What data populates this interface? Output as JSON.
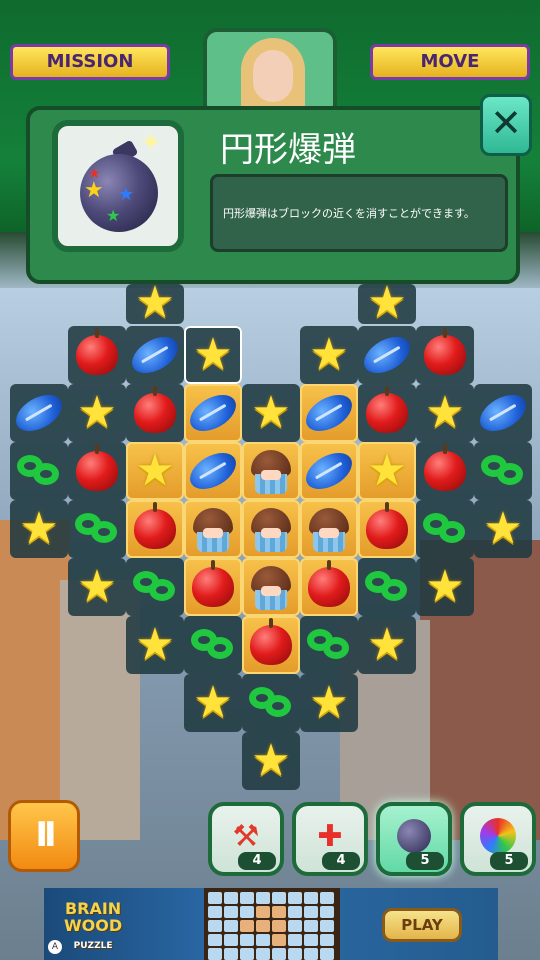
{
  "hud": {
    "mission_label": "MISSION",
    "move_label": "MOVE"
  },
  "dialog": {
    "title": "円形爆弾",
    "description": "円形爆弾はブロックの近くを消すことができます。",
    "close_glyph": "✕"
  },
  "board": {
    "pieces": [
      "apple",
      "football",
      "star",
      "pretzel",
      "cupcake"
    ],
    "note_cells": "heart-shaped grid of colored match-3 pieces"
  },
  "controls": {
    "pause_glyph": "II",
    "boosters": [
      {
        "name": "hammer",
        "count": "4"
      },
      {
        "name": "cross-bomb",
        "count": "4"
      },
      {
        "name": "round-bomb",
        "count": "5"
      },
      {
        "name": "color-pinwheel",
        "count": "5"
      }
    ]
  },
  "ad": {
    "logo_line1": "BRAIN",
    "logo_line2": "WOOD",
    "logo_line3": "PUZZLE",
    "play_label": "PLAY",
    "info_glyph": "A"
  },
  "colors": {
    "hud_green": "#14813a",
    "panel_green": "#2e8a4c",
    "close_teal": "#2fb894",
    "highlight_orange": "#e49b2a",
    "pause_orange": "#f28a12"
  }
}
